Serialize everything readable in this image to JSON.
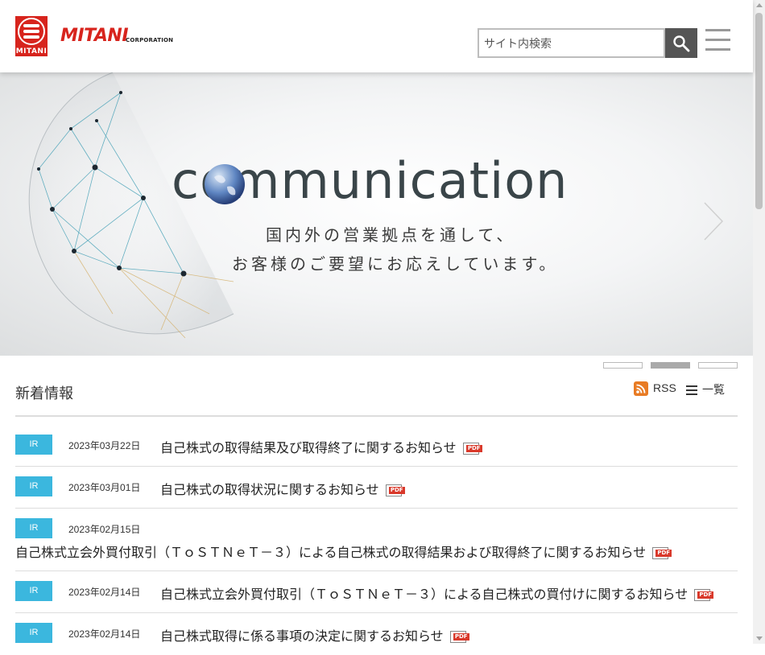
{
  "header": {
    "logo_mini": "MITANI",
    "logo_word": "MITANI",
    "logo_corp": "CORPORATION",
    "search_placeholder": "サイト内検索"
  },
  "hero": {
    "headline": "communication",
    "line1": "国内外の営業拠点を通して、",
    "line2": "お客様のご要望にお応えしています。"
  },
  "slider": {
    "count": 3,
    "active_index": 1
  },
  "news": {
    "title": "新着情報",
    "rss_label": "RSS",
    "list_label": "一覧",
    "items": [
      {
        "tag": "IR",
        "date": "2023年03月22日",
        "title": "自己株式の取得結果及び取得終了に関するお知らせ"
      },
      {
        "tag": "IR",
        "date": "2023年03月01日",
        "title": "自己株式の取得状況に関するお知らせ"
      },
      {
        "tag": "IR",
        "date": "2023年02月15日",
        "title": "自己株式立会外買付取引（ＴｏＳＴＮｅＴ－３）による自己株式の取得結果および取得終了に関するお知らせ"
      },
      {
        "tag": "IR",
        "date": "2023年02月14日",
        "title": "自己株式立会外買付取引（ＴｏＳＴＮｅＴ－３）による自己株式の買付けに関するお知らせ"
      },
      {
        "tag": "IR",
        "date": "2023年02月14日",
        "title": "自己株式取得に係る事項の決定に関するお知らせ"
      }
    ],
    "pdf_label": "PDF"
  },
  "colors": {
    "brand": "#d7241d",
    "tag": "#3bb7de",
    "rss": "#e87b24",
    "pdf": "#d9392b"
  },
  "icons": [
    "search-icon",
    "hamburger-menu-icon",
    "rss-icon",
    "list-icon",
    "pdf-icon",
    "chevron-right-icon"
  ]
}
